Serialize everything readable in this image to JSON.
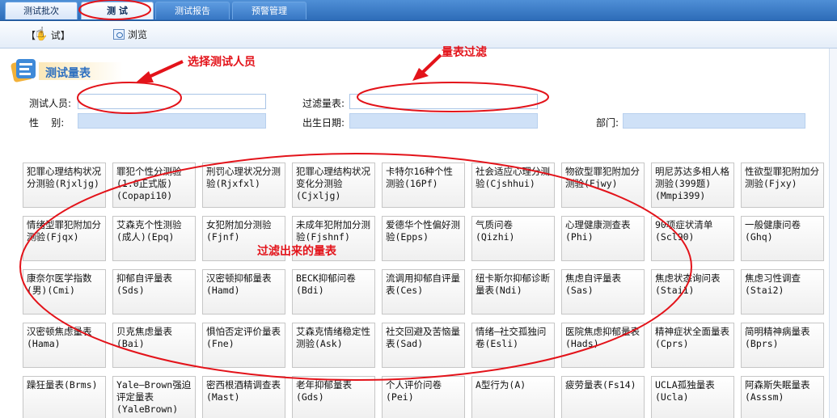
{
  "tabs": [
    {
      "label": "测试批次"
    },
    {
      "label": "测   试"
    },
    {
      "label": "测试报告"
    },
    {
      "label": "预警管理"
    }
  ],
  "toolbar": {
    "test_label": "【✋  试】",
    "browse_label": "浏览"
  },
  "section": {
    "title": "测试量表"
  },
  "form": {
    "tester_label": "测试人员:",
    "tester_value": "",
    "filter_label": "过滤量表:",
    "filter_value": "",
    "gender_label": "性    别:",
    "gender_value": "",
    "birth_label": "出生日期:",
    "birth_value": "",
    "dept_label": "部门:",
    "dept_value": ""
  },
  "annotations": {
    "select_tester": "选择测试人员",
    "scale_filter": "量表过滤",
    "filtered_result": "过滤出来的量表"
  },
  "scales": [
    "犯罪心理结构状况分测验(Rjxljg)",
    "罪犯个性分测验(1.0正式版)(Copapi10)",
    "刑罚心理状况分测验(Rjxfxl)",
    "犯罪心理结构状况变化分测验(Cjxljg)",
    "卡特尔16种个性测验(16Pf)",
    "社会适应心理分测验(Cjshhui)",
    "物欲型罪犯附加分测验(Fjwy)",
    "明尼苏达多相人格测验(399题)(Mmpi399)",
    "性欲型罪犯附加分测验(Fjxy)",
    "情绪型罪犯附加分测验(Fjqx)",
    "艾森克个性测验(成人)(Epq)",
    "女犯附加分测验(Fjnf)",
    "未成年犯附加分测验(Fjshnf)",
    "爱德华个性偏好测验(Epps)",
    "气质问卷(Qizhi)",
    "心理健康测查表(Phi)",
    "90项症状清单(Scl90)",
    "一般健康问卷(Ghq)",
    "康奈尔医学指数(男)(Cmi)",
    "抑郁自评量表(Sds)",
    "汉密顿抑郁量表(Hamd)",
    "BECK抑郁问卷(Bdi)",
    "流调用抑郁自评量表(Ces)",
    "纽卡斯尔抑郁诊断量表(Ndi)",
    "焦虑自评量表(Sas)",
    "焦虑状态询问表(Stai1)",
    "焦虑习性调查(Stai2)",
    "汉密顿焦虑量表(Hama)",
    "贝克焦虑量表(Bai)",
    "惧怕否定评价量表(Fne)",
    "艾森克情绪稳定性测验(Ask)",
    "社交回避及苦恼量表(Sad)",
    "情绪—社交孤独问卷(Esli)",
    "医院焦虑抑郁量表(Hads)",
    "精神症状全面量表(Cprs)",
    "简明精神病量表(Bprs)",
    "躁狂量表(Brms)",
    "Yale—Brown强迫评定量表(YaleBrown)",
    "密西根酒精调查表(Mast)",
    "老年抑郁量表(Gds)",
    "个人评价问卷(Pei)",
    "A型行为(A)",
    "疲劳量表(Fs14)",
    "UCLA孤独量表(Ucla)",
    "阿森斯失眠量表(Asssm)"
  ]
}
